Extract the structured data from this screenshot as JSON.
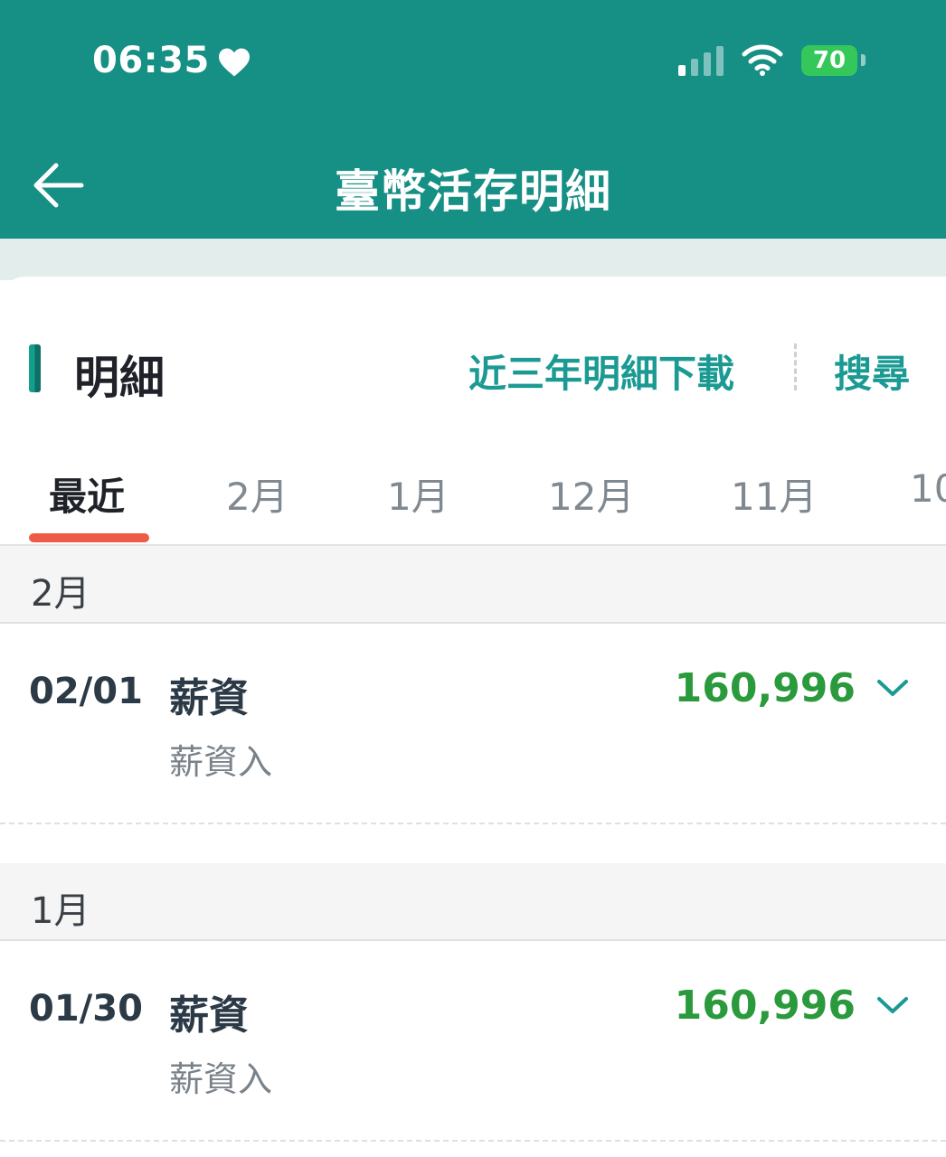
{
  "status_bar": {
    "time": "06:35",
    "battery": "70"
  },
  "header": {
    "title": "臺幣活存明細"
  },
  "section": {
    "title": "明細",
    "download_label": "近三年明細下載",
    "search_label": "搜尋"
  },
  "tabs": [
    {
      "label": "最近"
    },
    {
      "label": "2月"
    },
    {
      "label": "1月"
    },
    {
      "label": "12月"
    },
    {
      "label": "11月"
    },
    {
      "label": "10"
    }
  ],
  "groups": [
    {
      "month": "2月",
      "transactions": [
        {
          "date": "02/01",
          "title": "薪資",
          "subtitle": "薪資入",
          "amount": "160,996"
        }
      ]
    },
    {
      "month": "1月",
      "transactions": [
        {
          "date": "01/30",
          "title": "薪資",
          "subtitle": "薪資入",
          "amount": "160,996"
        }
      ]
    }
  ],
  "colors": {
    "header_bg": "#168f85",
    "accent": "#1a9a93",
    "amount": "#2a9a3c",
    "tab_indicator": "#ef5a46"
  },
  "icons": {
    "back": "arrow-left-icon",
    "expand": "chevron-down-icon"
  }
}
